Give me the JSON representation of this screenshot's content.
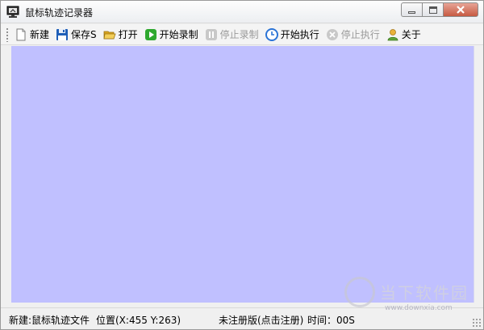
{
  "window": {
    "title": "鼠标轨迹记录器"
  },
  "toolbar": {
    "items": [
      {
        "label": "新建",
        "icon": "new-file-icon",
        "enabled": true
      },
      {
        "label": "保存S",
        "icon": "floppy-disk-icon",
        "enabled": true
      },
      {
        "label": "打开",
        "icon": "open-folder-icon",
        "enabled": true
      },
      {
        "label": "开始录制",
        "icon": "play-icon",
        "enabled": true
      },
      {
        "label": "停止录制",
        "icon": "pause-icon",
        "enabled": false
      },
      {
        "label": "开始执行",
        "icon": "clock-icon",
        "enabled": true
      },
      {
        "label": "停止执行",
        "icon": "stop-circle-icon",
        "enabled": false
      },
      {
        "label": "关于",
        "icon": "user-icon",
        "enabled": true
      }
    ]
  },
  "canvas": {
    "color": "#c0c0ff"
  },
  "status": {
    "file": "新建:鼠标轨迹文件",
    "position": "位置(X:455 Y:263)",
    "register": "未注册版(点击注册)",
    "time": "时间：00S"
  },
  "watermark": {
    "brand": "当下软件园",
    "url": "www.downxia.com"
  }
}
